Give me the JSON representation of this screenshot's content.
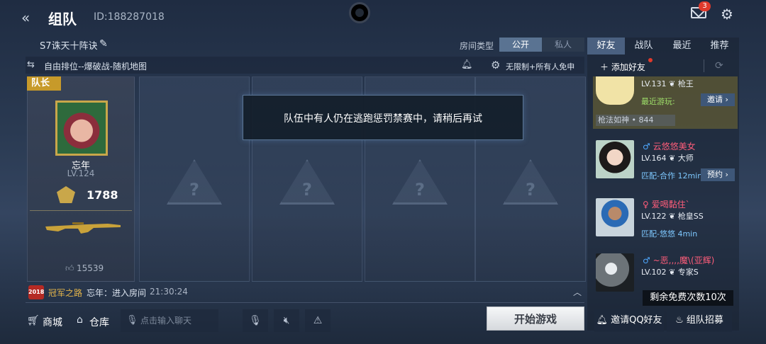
{
  "header": {
    "back_icon": "double-chevron-left-icon",
    "title": "组队",
    "team_id": "ID:188287018",
    "mail_badge": "3",
    "mail_icon": "mail-icon",
    "settings_icon": "gear-icon"
  },
  "room": {
    "name": "S7诛天十阵诀",
    "type_label": "房间类型",
    "type_options": [
      "公开",
      "私人"
    ],
    "selected_type": "公开"
  },
  "mode": {
    "text": "自由排位--爆破战-随机地图",
    "limit_text": "无限制+所有人免申"
  },
  "leader": {
    "tag": "队长",
    "name": "忘年",
    "level": "LV.124",
    "rank_score": "1788",
    "likes": "15539"
  },
  "toast": {
    "message": "队伍中有人仍在逃跑惩罚禁赛中，请稍后再试"
  },
  "event": {
    "badge": "2018",
    "title": "冠军之路",
    "text": "忘年：进入房间",
    "time": "21:30:24"
  },
  "bottom": {
    "shop_label": "商城",
    "warehouse_label": "仓库",
    "chat_placeholder": "点击输入聊天",
    "start_label": "开始游戏"
  },
  "friends": {
    "tabs": [
      "好友",
      "战队",
      "最近",
      "推荐"
    ],
    "active_tab": "好友",
    "add_label": "添加好友",
    "list": [
      {
        "name": "",
        "level": "LV.131",
        "title": "枪王",
        "status": "最近游玩:",
        "button": "邀请",
        "sub": "枪法如神 • 844",
        "status_color": "#9fe06a"
      },
      {
        "name": "云悠悠美女",
        "level": "LV.164",
        "title": "大师",
        "status": "匹配-合作 12min",
        "button": "预约",
        "gender": "male",
        "name_color": "#ff5d7a",
        "status_color": "#7ec8ff"
      },
      {
        "name": "爱喝黏住`",
        "level": "LV.122",
        "title": "枪皇SS",
        "status": "匹配-悠悠 4min",
        "button": "",
        "gender": "female",
        "name_color": "#ff5d7a",
        "status_color": "#7ec8ff"
      },
      {
        "name": "~恶,,,,魔\\(亚辉)",
        "level": "LV.102",
        "title": "专家S",
        "status": "",
        "button": "",
        "gender": "male",
        "name_color": "#ff5d7a",
        "status_color": "#7ec8ff"
      }
    ],
    "free_count": "剩余免费次数10次",
    "invite_qq": "邀请QQ好友",
    "recruit": "组队招募"
  }
}
